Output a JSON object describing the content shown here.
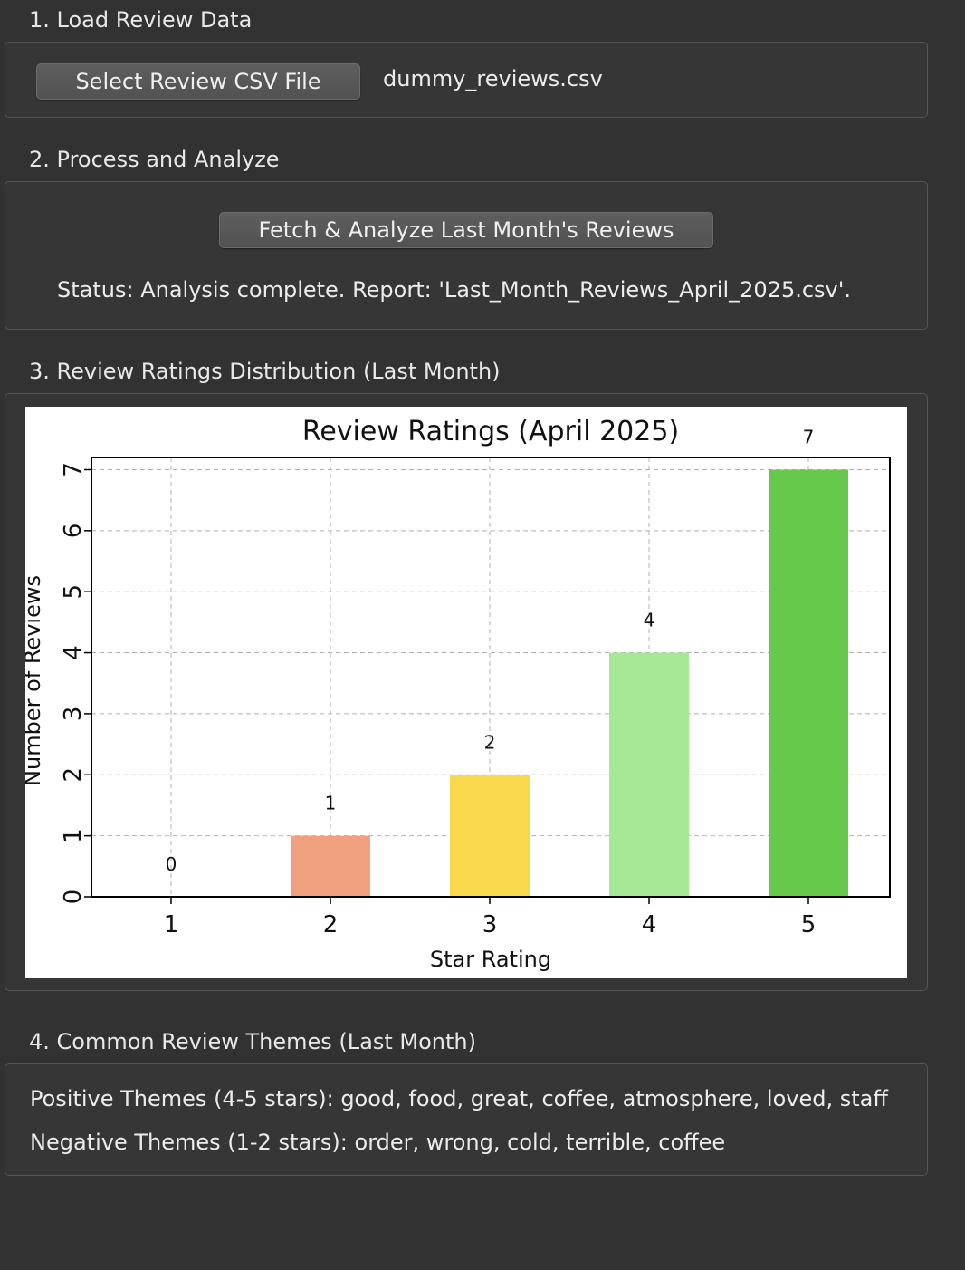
{
  "sections": {
    "load": {
      "title": "1. Load Review Data",
      "button_label": "Select Review CSV File",
      "file_name": "dummy_reviews.csv"
    },
    "process": {
      "title": "2. Process and Analyze",
      "button_label": "Fetch & Analyze Last Month's Reviews",
      "status": "Status: Analysis complete. Report: 'Last_Month_Reviews_April_2025.csv'."
    },
    "chart": {
      "title": "3. Review Ratings Distribution (Last Month)"
    },
    "themes": {
      "title": "4. Common Review Themes (Last Month)",
      "positive": "Positive Themes (4-5 stars): good, food, great, coffee, atmosphere, loved, staff",
      "negative": "Negative Themes (1-2 stars): order, wrong, cold, terrible, coffee"
    }
  },
  "chart_data": {
    "type": "bar",
    "title": "Review Ratings (April 2025)",
    "xlabel": "Star Rating",
    "ylabel": "Number of Reviews",
    "categories": [
      "1",
      "2",
      "3",
      "4",
      "5"
    ],
    "values": [
      0,
      1,
      2,
      4,
      7
    ],
    "colors": [
      "#e8604c",
      "#f0a07e",
      "#f8d84c",
      "#a6e896",
      "#66c94c"
    ],
    "yticks": [
      "0",
      "1",
      "2",
      "3",
      "4",
      "5",
      "6",
      "7"
    ],
    "ylim": [
      0,
      7.2
    ],
    "grid": true
  }
}
